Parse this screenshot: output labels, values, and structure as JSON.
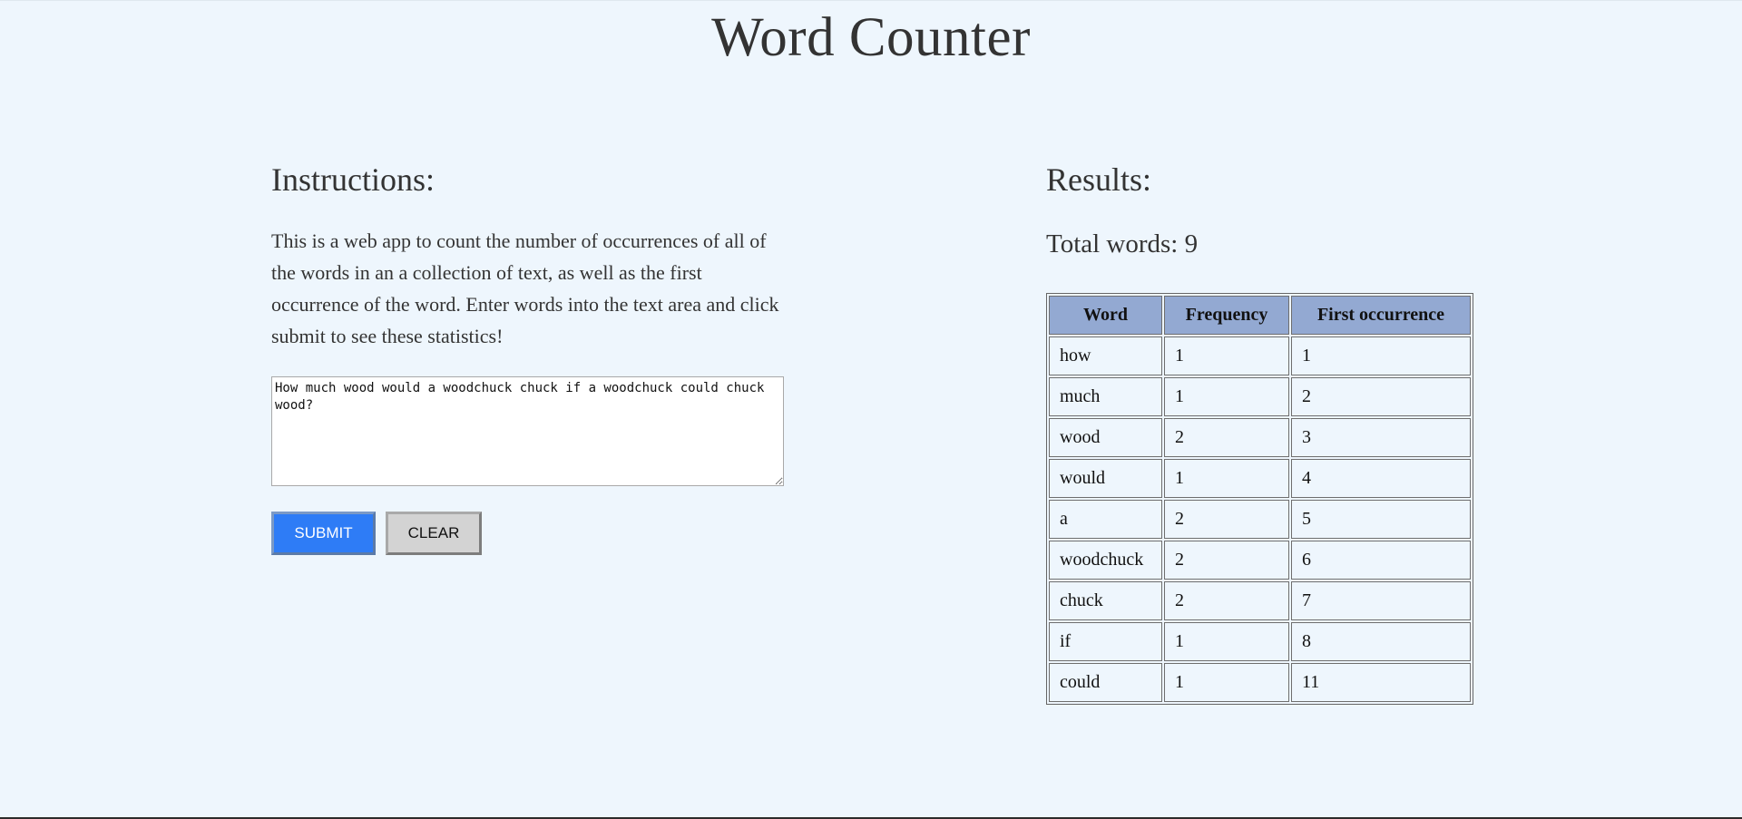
{
  "page": {
    "title": "Word Counter"
  },
  "instructions": {
    "heading": "Instructions:",
    "text": "This is a web app to count the number of occurrences of all of the words in an a collection of text, as well as the first occurrence of the word. Enter words into the text area and click submit to see these statistics!",
    "input_value": "How much wood would a woodchuck chuck if a woodchuck could chuck wood?",
    "submit_label": "SUBMIT",
    "clear_label": "CLEAR"
  },
  "results": {
    "heading": "Results:",
    "total_words": "Total words: 9",
    "columns": [
      "Word",
      "Frequency",
      "First occurrence"
    ],
    "rows": [
      {
        "word": "how",
        "frequency": "1",
        "first": "1"
      },
      {
        "word": "much",
        "frequency": "1",
        "first": "2"
      },
      {
        "word": "wood",
        "frequency": "2",
        "first": "3"
      },
      {
        "word": "would",
        "frequency": "1",
        "first": "4"
      },
      {
        "word": "a",
        "frequency": "2",
        "first": "5"
      },
      {
        "word": "woodchuck",
        "frequency": "2",
        "first": "6"
      },
      {
        "word": "chuck",
        "frequency": "2",
        "first": "7"
      },
      {
        "word": "if",
        "frequency": "1",
        "first": "8"
      },
      {
        "word": "could",
        "frequency": "1",
        "first": "11"
      }
    ]
  },
  "colors": {
    "background": "#eef6fd",
    "table_header": "#93a9d2",
    "submit_button": "#2e7cf6",
    "clear_button": "#d3d3d3"
  }
}
